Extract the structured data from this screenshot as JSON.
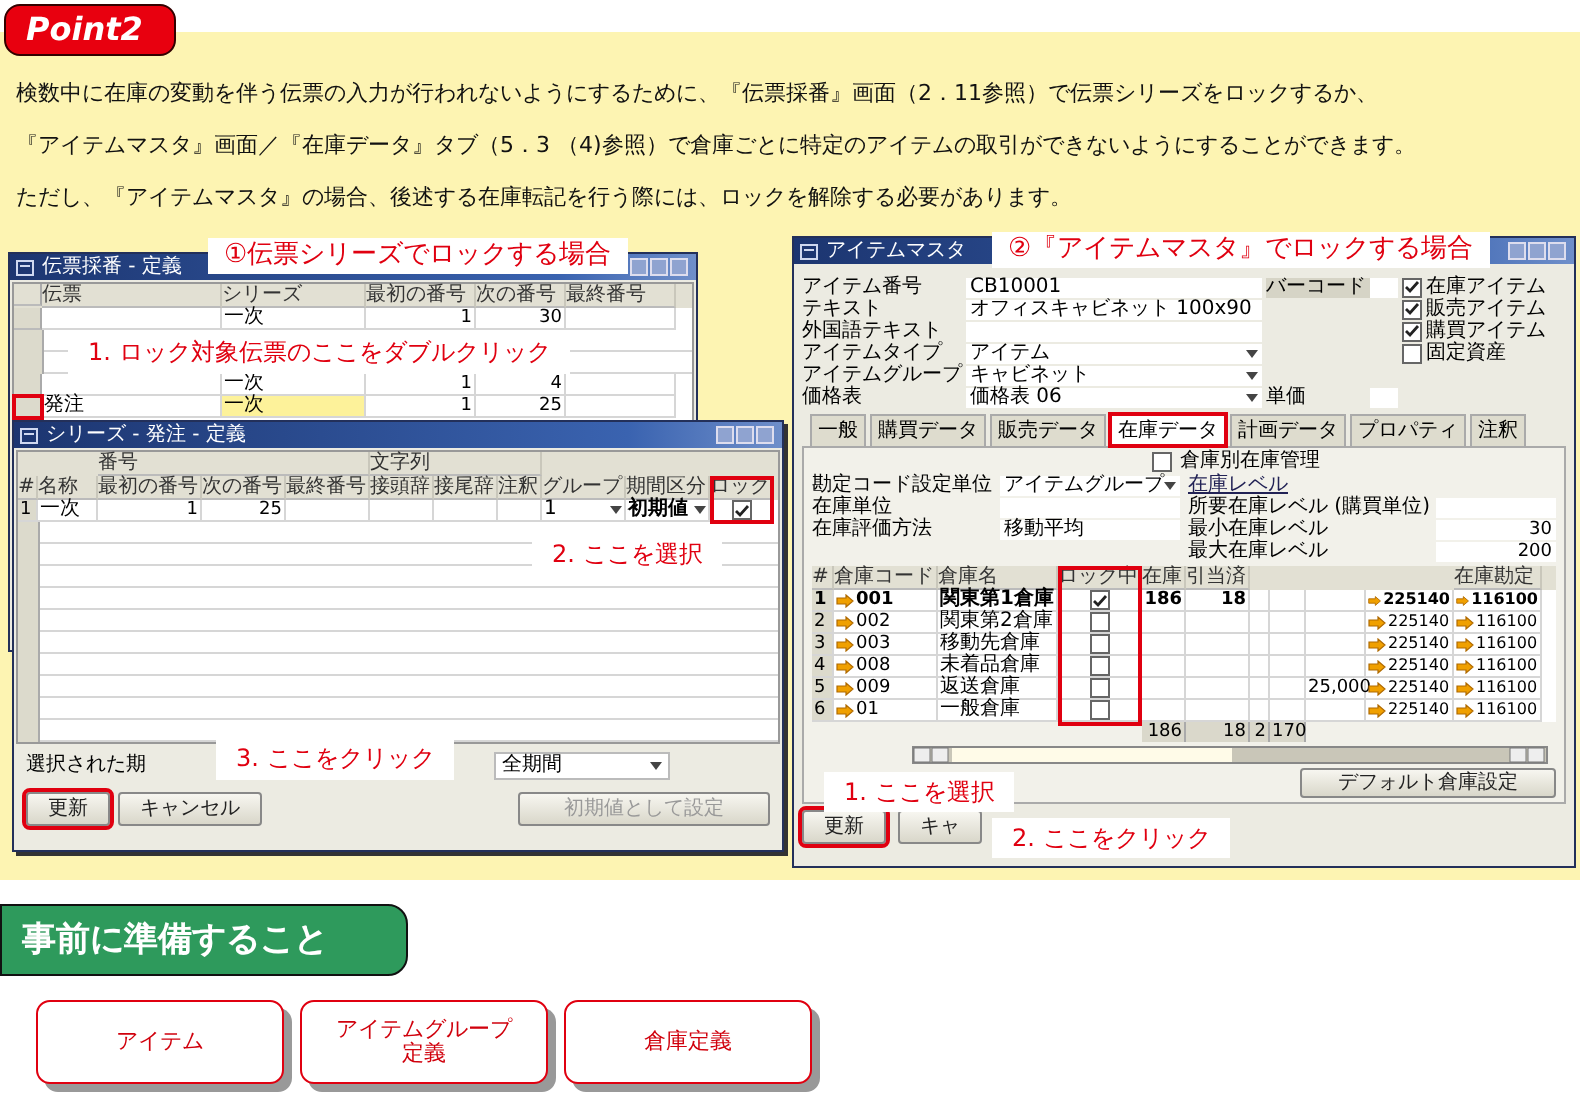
{
  "badge": "Point2",
  "intro": [
    "検数中に在庫の変動を伴う伝票の入力が行われないようにするために、『伝票採番』画面（2．11参照）で伝票シリーズをロックするか、",
    "『アイテムマスタ』画面／『在庫データ』タブ（5．3 （4)参照）で倉庫ごとに特定のアイテムの取引ができないようにすることができます。",
    "ただし、『アイテムマスタ』の場合、後述する在庫転記を行う際には、ロックを解除する必要があります。"
  ],
  "left": {
    "caption": "①伝票シリーズでロックする場合",
    "back_window": {
      "title": "伝票採番 - 定義",
      "columns": {
        "doc": "伝票",
        "series": "シリーズ",
        "first": "最初の番号",
        "next": "次の番号",
        "last": "最終番号"
      },
      "rows": [
        {
          "series": "一次",
          "first": "1",
          "next": "30",
          "selected": false
        },
        {
          "series": "一次",
          "first": "1",
          "next": "4",
          "selected": false
        },
        {
          "doc": "発注",
          "series": "一次",
          "first": "1",
          "next": "25",
          "selected": true
        }
      ]
    },
    "front_window": {
      "title": "シリーズ - 発注 - 定義",
      "groups": {
        "number": "番号",
        "string": "文字列"
      },
      "columns": {
        "num": "#",
        "name": "名称",
        "first": "最初の番号",
        "next": "次の番号",
        "last": "最終番号",
        "prefix": "接頭辞",
        "suffix": "接尾辞",
        "remarks": "注釈",
        "group": "グループ",
        "period": "期間区分",
        "locked": "ロック"
      },
      "rows": [
        {
          "num": "1",
          "name": "一次",
          "first": "1",
          "next": "25",
          "group": "1",
          "period": "初期値",
          "locked": true
        }
      ],
      "period_label": "選択された期",
      "period_select": "全期間",
      "buttons": [
        {
          "label": "更新",
          "disabled": false,
          "highlight": true
        },
        {
          "label": "キャンセル",
          "disabled": false,
          "highlight": false
        },
        {
          "label": "初期値として設定",
          "disabled": true,
          "highlight": false
        }
      ]
    },
    "callouts": [
      "1. ロック対象伝票のここをダブルクリック",
      "2. ここを選択",
      "3. ここをクリック"
    ]
  },
  "right": {
    "caption": "②『アイテムマスタ』でロックする場合",
    "window": {
      "title": "アイテムマスタ",
      "fields": [
        {
          "label": "アイテム番号",
          "value": "CB10001",
          "dropdown": false
        },
        {
          "label": "テキスト",
          "value": "オフィスキャビネット 100x90",
          "dropdown": false
        },
        {
          "label": "外国語テキスト",
          "dropdown": false
        },
        {
          "label": "アイテムタイプ",
          "value": "アイテム",
          "dropdown": true
        },
        {
          "label": "アイテムグループ",
          "value": "キャビネット",
          "dropdown": true
        },
        {
          "label": "価格表",
          "value": "価格表 06",
          "dropdown": true
        }
      ],
      "barcode_label": "バーコード",
      "price_label": "単価",
      "flags": [
        {
          "label": "在庫アイテム",
          "checked": true
        },
        {
          "label": "販売アイテム",
          "checked": true
        },
        {
          "label": "購買アイテム",
          "checked": true
        },
        {
          "label": "固定資産",
          "checked": false
        }
      ],
      "tabs": [
        {
          "label": "一般",
          "selected": false
        },
        {
          "label": "購買データ",
          "selected": false
        },
        {
          "label": "販売データ",
          "selected": false
        },
        {
          "label": "在庫データ",
          "selected": true
        },
        {
          "label": "計画データ",
          "selected": false
        },
        {
          "label": "プロパティ",
          "selected": false
        },
        {
          "label": "注釈",
          "selected": false
        }
      ],
      "warehouse_mgmt": {
        "label": "倉庫別在庫管理",
        "checked": false
      },
      "settings": [
        {
          "label": "勘定コード設定単位",
          "value": "アイテムグループ",
          "dropdown": true
        },
        {
          "label": "在庫単位",
          "dropdown": false
        },
        {
          "label": "在庫評価方法",
          "value": "移動平均",
          "dropdown": false
        }
      ],
      "levels_link": "在庫レベル",
      "levels": [
        {
          "label": "所要在庫レベル (購買単位)"
        },
        {
          "label": "最小在庫レベル",
          "value": "30"
        },
        {
          "label": "最大在庫レベル",
          "value": "200"
        }
      ],
      "table": {
        "columns": {
          "num": "#",
          "code": "倉庫コード",
          "name": "倉庫名",
          "locked": "ロック中",
          "stock": "在庫",
          "committed": "引当済",
          "inventory": "在庫勘定"
        },
        "rows": [
          {
            "num": "1",
            "code": "001",
            "name": "関東第1倉庫",
            "locked": true,
            "stock": "186",
            "committed": "18",
            "expense": "225140",
            "inventory": "116100",
            "selected": true
          },
          {
            "num": "2",
            "code": "002",
            "name": "関東第2倉庫",
            "locked": false,
            "expense": "225140",
            "inventory": "116100",
            "selected": false
          },
          {
            "num": "3",
            "code": "003",
            "name": "移動先倉庫",
            "locked": false,
            "expense": "225140",
            "inventory": "116100",
            "selected": false
          },
          {
            "num": "4",
            "code": "008",
            "name": "未着品倉庫",
            "locked": false,
            "expense": "225140",
            "inventory": "116100",
            "selected": false
          },
          {
            "num": "5",
            "code": "009",
            "name": "返送倉庫",
            "locked": false,
            "col_9": "25,000",
            "expense": "225140",
            "inventory": "116100",
            "selected": false
          },
          {
            "num": "6",
            "code": "01",
            "name": "一般倉庫",
            "locked": false,
            "expense": "225140",
            "inventory": "116100",
            "selected": false
          }
        ],
        "totals": {
          "stock": "186",
          "committed": "18",
          "col_7": "2",
          "col_8": "170"
        },
        "default_button": "デフォルト倉庫設定"
      },
      "buttons": [
        {
          "label": "更新",
          "highlight": true
        },
        {
          "label": "キャ",
          "highlight": false
        }
      ]
    },
    "callouts": [
      "1. ここを選択",
      "2. ここをクリック"
    ]
  },
  "prep": {
    "title": "事前に準備すること",
    "items": [
      "アイテム",
      "アイテムグループ定義",
      "倉庫定義"
    ]
  }
}
